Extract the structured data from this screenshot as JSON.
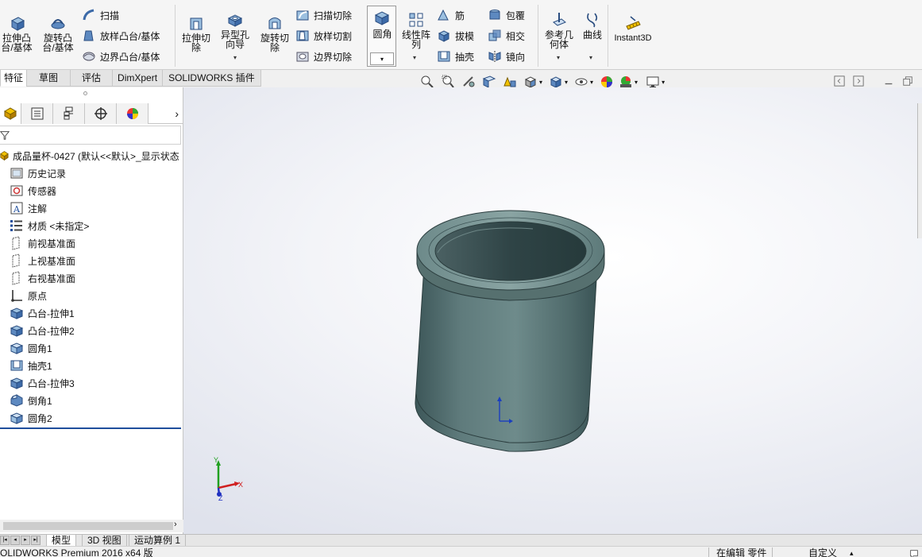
{
  "ribbon": {
    "extrude_boss": "拉伸凸台/基体",
    "revolve_boss": "旋转凸台/基体",
    "sweep": "扫描",
    "loft": "放样凸台/基体",
    "boundary": "边界凸台/基体",
    "extrude_cut": "拉伸切除",
    "hole_wizard": "异型孔向导",
    "revolve_cut": "旋转切除",
    "sweep_cut": "扫描切除",
    "loft_cut": "放样切割",
    "boundary_cut": "边界切除",
    "fillet": "圆角",
    "linear_pattern": "线性阵列",
    "rib": "筋",
    "draft": "拔模",
    "shell": "抽壳",
    "wrap": "包覆",
    "intersect": "相交",
    "mirror": "镜向",
    "ref_geometry": "参考几何体",
    "curves": "曲线",
    "instant3d": "Instant3D"
  },
  "tabs": [
    "特征",
    "草图",
    "评估",
    "DimXpert",
    "SOLIDWORKS 插件"
  ],
  "tree": {
    "root": "成品量杯-0427  (默认<<默认>_显示状态",
    "items": [
      "历史记录",
      "传感器",
      "注解",
      "材质 <未指定>",
      "前视基准面",
      "上视基准面",
      "右视基准面",
      "原点",
      "凸台-拉伸1",
      "凸台-拉伸2",
      "圆角1",
      "抽壳1",
      "凸台-拉伸3",
      "倒角1",
      "圆角2"
    ]
  },
  "bottom_tabs": [
    "模型",
    "3D 视图",
    "运动算例 1"
  ],
  "status": {
    "app": "SOLIDWORKS Premium 2016 x64 版",
    "editing": "在编辑 零件",
    "custom": "自定义"
  },
  "triad": {
    "x": "X",
    "y": "Y",
    "z": "Z"
  },
  "colors": {
    "part_body": "#4f6b6d",
    "accent_blue": "#1f4e9c"
  }
}
